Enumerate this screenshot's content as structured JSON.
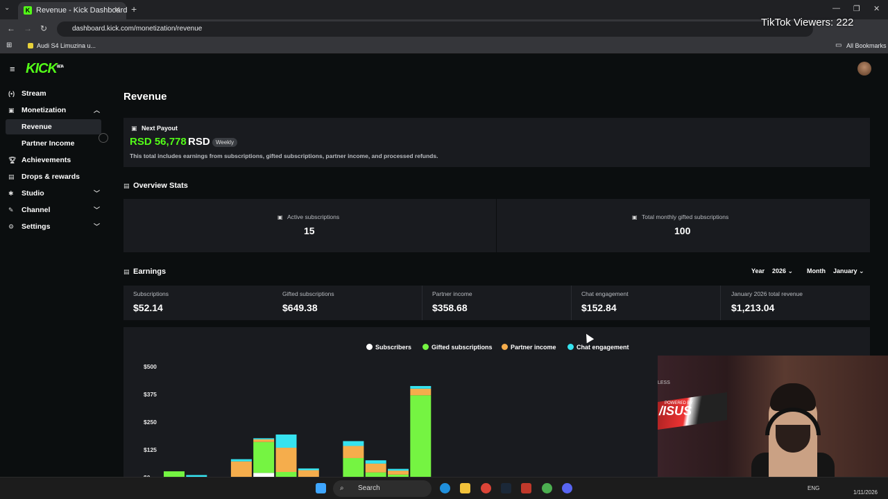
{
  "browser": {
    "tab_title": "Revenue - Kick Dashboard",
    "url": "dashboard.kick.com/monetization/revenue",
    "bookmark": "Audi S4 Limuzina u...",
    "all_bookmarks": "All Bookmarks"
  },
  "overlay": {
    "tiktok_viewers": "TikTok Viewers: 222"
  },
  "app": {
    "logo": "KICK",
    "logo_badge": "BETA"
  },
  "sidebar": {
    "items": [
      {
        "label": "Stream",
        "icon": "broadcast-icon"
      },
      {
        "label": "Monetization",
        "icon": "monetization-icon",
        "chevron": "up"
      },
      {
        "label": "Revenue",
        "active": true
      },
      {
        "label": "Partner Income"
      },
      {
        "label": "Achievements",
        "icon": "trophy-icon"
      },
      {
        "label": "Drops & rewards",
        "icon": "gift-icon"
      },
      {
        "label": "Studio",
        "icon": "studio-icon",
        "chevron": "down"
      },
      {
        "label": "Channel",
        "icon": "channel-icon",
        "chevron": "down"
      },
      {
        "label": "Settings",
        "icon": "gear-icon",
        "chevron": "down"
      }
    ]
  },
  "page": {
    "title": "Revenue"
  },
  "payout": {
    "label": "Next Payout",
    "amount": "RSD 56,778",
    "currency": "RSD",
    "badge": "Weekly",
    "description": "This total includes earnings from subscriptions, gifted subscriptions, partner income, and processed refunds."
  },
  "overview": {
    "title": "Overview Stats",
    "stats": [
      {
        "label": "Active subscriptions",
        "value": "15"
      },
      {
        "label": "Total monthly gifted subscriptions",
        "value": "100"
      }
    ]
  },
  "earnings": {
    "title": "Earnings",
    "year_label": "Year",
    "year_value": "2026",
    "month_label": "Month",
    "month_value": "January",
    "items": [
      {
        "label": "Subscriptions",
        "value": "$52.14"
      },
      {
        "label": "Gifted subscriptions",
        "value": "$649.38"
      },
      {
        "label": "Partner income",
        "value": "$358.68"
      },
      {
        "label": "Chat engagement",
        "value": "$152.84"
      },
      {
        "label": "January 2026 total revenue",
        "value": "$1,213.04"
      }
    ]
  },
  "colors": {
    "subscribers": "#ffffff",
    "gifted": "#75f442",
    "partner": "#f5ad4c",
    "chat": "#36e3ef",
    "brand": "#53fc18"
  },
  "chart_data": {
    "type": "bar",
    "stacked": true,
    "y_ticks": [
      "$500",
      "$375",
      "$250",
      "$125",
      "$0"
    ],
    "ylim": [
      0,
      500
    ],
    "legend": [
      "Subscribers",
      "Gifted subscriptions",
      "Partner income",
      "Chat engagement"
    ],
    "series": [
      {
        "name": "Subscribers",
        "values": [
          0,
          0,
          0,
          0,
          18,
          0,
          0,
          0,
          0,
          0,
          0,
          0
        ]
      },
      {
        "name": "Gifted subscriptions",
        "values": [
          25,
          0,
          0,
          0,
          140,
          22,
          0,
          0,
          85,
          20,
          10,
          370
        ]
      },
      {
        "name": "Partner income",
        "values": [
          0,
          0,
          0,
          70,
          12,
          110,
          30,
          0,
          55,
          40,
          18,
          30
        ]
      },
      {
        "name": "Chat engagement",
        "values": [
          0,
          8,
          0,
          10,
          5,
          60,
          8,
          0,
          22,
          15,
          8,
          12
        ]
      }
    ]
  },
  "taskbar": {
    "search": "Search",
    "lang": "ENG",
    "date": "1/11/2026"
  }
}
